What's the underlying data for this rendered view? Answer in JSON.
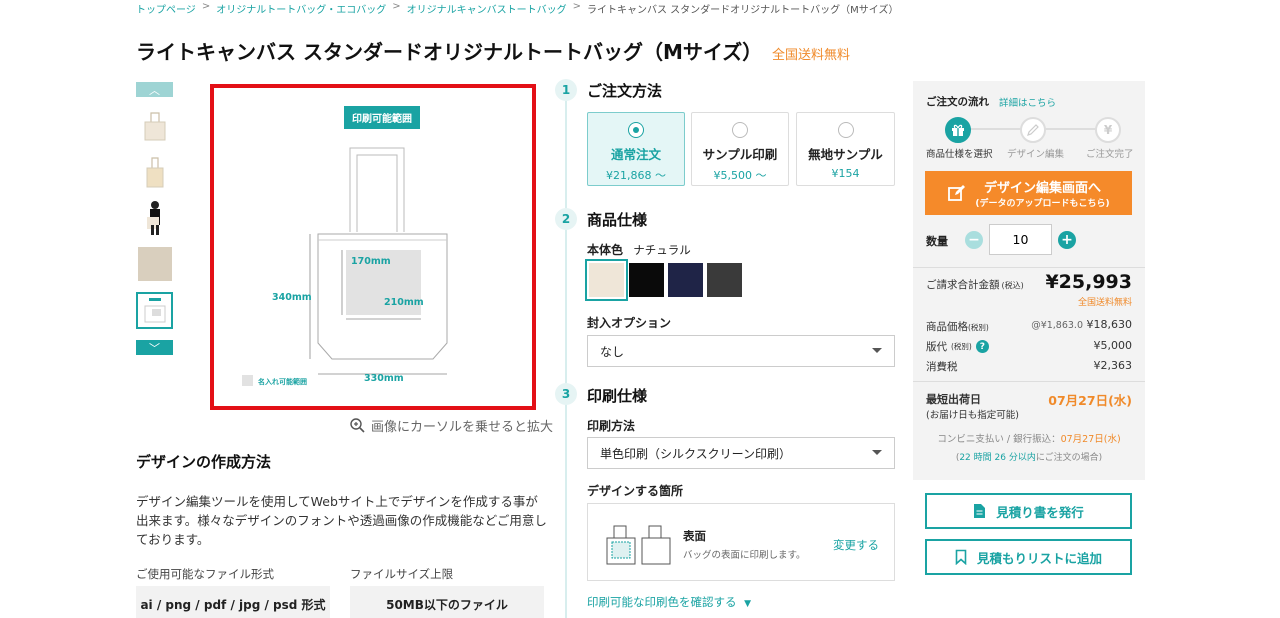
{
  "breadcrumb": [
    {
      "label": "トップページ",
      "link": true
    },
    {
      "label": "オリジナルトートバッグ・エコバッグ",
      "link": true
    },
    {
      "label": "オリジナルキャンバストートバッグ",
      "link": true
    },
    {
      "label": "ライトキャンバス スタンダードオリジナルトートバッグ（Mサイズ）",
      "link": false
    }
  ],
  "title": "ライトキャンバス スタンダードオリジナルトートバッグ（Mサイズ）",
  "shipping_badge": "全国送料無料",
  "image": {
    "print_area_badge": "印刷可能範囲",
    "dim_print_height": "170mm",
    "dim_print_width": "210mm",
    "dim_bag_height": "340mm",
    "dim_bag_width": "330mm",
    "name_area_label": "名入れ可能範囲",
    "zoom_hint": "画像にカーソルを乗せると拡大"
  },
  "design_method": {
    "heading": "デザインの作成方法",
    "body": "デザイン編集ツールを使用してWebサイト上でデザインを作成する事が出来ます。様々なデザインのフォントや透過画像の作成機能などご用意しております。",
    "formats_label": "ご使用可能なファイル形式",
    "formats_value": "ai / png / pdf / jpg / psd 形式",
    "size_label": "ファイルサイズ上限",
    "size_value": "50MB以下のファイル"
  },
  "steps": {
    "s1": {
      "num": "1",
      "title": "ご注文方法"
    },
    "s2": {
      "num": "2",
      "title": "商品仕様"
    },
    "s3": {
      "num": "3",
      "title": "印刷仕様"
    }
  },
  "order_options": [
    {
      "name": "通常注文",
      "price": "¥21,868 〜",
      "selected": true
    },
    {
      "name": "サンプル印刷",
      "price": "¥5,500 〜",
      "selected": false
    },
    {
      "name": "無地サンプル",
      "price": "¥154",
      "selected": false
    }
  ],
  "body_color": {
    "label": "本体色",
    "value": "ナチュラル"
  },
  "swatches": [
    "#efe6d8",
    "#0a0a0a",
    "#1f2447",
    "#3a3a3a"
  ],
  "enclosure": {
    "label": "封入オプション",
    "value": "なし"
  },
  "print_method": {
    "label": "印刷方法",
    "value": "単色印刷（シルクスクリーン印刷）"
  },
  "design_location": {
    "label": "デザインする箇所",
    "name": "表面",
    "desc": "バッグの表面に印刷します。",
    "change": "変更する"
  },
  "print_colors_link": "印刷可能な印刷色を確認する",
  "panel": {
    "flow_title": "ご注文の流れ",
    "flow_link": "詳細はこちら",
    "flow_steps": [
      "商品仕様を選択",
      "デザイン編集",
      "ご注文完了"
    ],
    "cta_main": "デザイン編集画面へ",
    "cta_sub": "(データのアップロードもこちら)",
    "qty_label": "数量",
    "qty_value": "10",
    "total_label": "ご請求合計金額",
    "total_tax": "(税込)",
    "total_value": "¥25,993",
    "total_note": "全国送料無料",
    "price_label": "商品価格",
    "price_tax": "(税別)",
    "price_unit": "@¥1,863.0",
    "price_value": "¥18,630",
    "plate_label": "版代",
    "plate_tax": "(税別)",
    "plate_value": "¥5,000",
    "tax_label": "消費税",
    "tax_value": "¥2,363",
    "ship_label": "最短出荷日",
    "ship_value": "07月27日(水)",
    "ship_note": "(お届け日も指定可能)",
    "conv_label": "コンビニ支払い / 銀行振込：",
    "conv_date": "07月27日(水)",
    "deadline_pre": "(",
    "deadline_time": "22 時間 26 分以内",
    "deadline_post": "にご注文の場合)"
  },
  "quote_button": "見積り書を発行",
  "wishlist_button": "見積もりリストに追加",
  "colors": {
    "teal": "#1aa3a3",
    "orange": "#f58a2a",
    "red_frame": "#e30f16"
  }
}
